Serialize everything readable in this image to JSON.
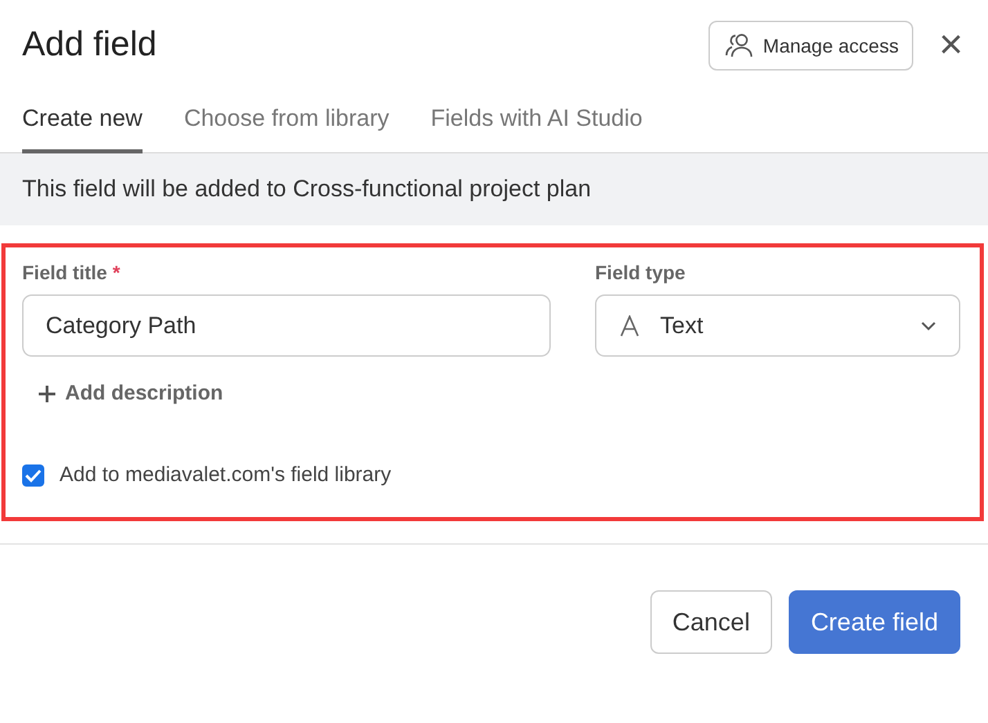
{
  "dialog": {
    "title": "Add field",
    "manage_access": "Manage access",
    "close": "×"
  },
  "tabs": [
    {
      "label": "Create new",
      "selected": true
    },
    {
      "label": "Choose from library",
      "selected": false
    },
    {
      "label": "Fields with AI Studio",
      "selected": false
    }
  ],
  "banner": "This field will be added to Cross-functional project plan",
  "form": {
    "title_label": "Field title",
    "required_mark": "*",
    "title_value": "Category Path",
    "type_label": "Field type",
    "type_value": "Text",
    "add_description": "Add description",
    "library_checkbox": {
      "label": "Add to mediavalet.com's field library",
      "checked": true
    }
  },
  "buttons": [
    {
      "label": "Cancel",
      "kind": "secondary"
    },
    {
      "label": "Create field",
      "kind": "primary"
    }
  ]
}
